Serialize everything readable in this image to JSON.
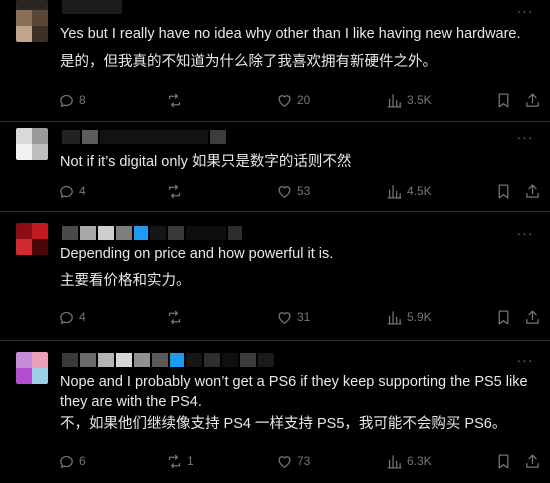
{
  "replies": [
    {
      "text": "Yes but I really have no idea why other than I like having new hardware.",
      "translation": "是的，但我真的不知道为什么除了我喜欢拥有新硬件之外。",
      "replies_count": "8",
      "reposts_count": "",
      "likes_count": "20",
      "views_count": "3.5K"
    },
    {
      "text": "Not if it’s digital only 如果只是数字的话则不然",
      "translation": "",
      "replies_count": "4",
      "reposts_count": "",
      "likes_count": "53",
      "views_count": "4.5K"
    },
    {
      "text": "Depending on price and how powerful it is.",
      "translation": "主要看价格和实力。",
      "replies_count": "4",
      "reposts_count": "",
      "likes_count": "31",
      "views_count": "5.9K"
    },
    {
      "text": "Nope and I probably won’t get a PS6 if they keep supporting the PS5 like they are with the PS4.",
      "translation": "不，如果他们继续像支持 PS4 一样支持 PS5，我可能不会购买 PS6。",
      "replies_count": "6",
      "reposts_count": "1",
      "likes_count": "73",
      "views_count": "6.3K"
    }
  ],
  "icons": {
    "reply": "reply-icon",
    "repost": "repost-icon",
    "like": "heart-icon",
    "views": "views-icon",
    "bookmark": "bookmark-icon",
    "share": "share-icon",
    "more": "more-icon"
  },
  "more_glyph": "···"
}
